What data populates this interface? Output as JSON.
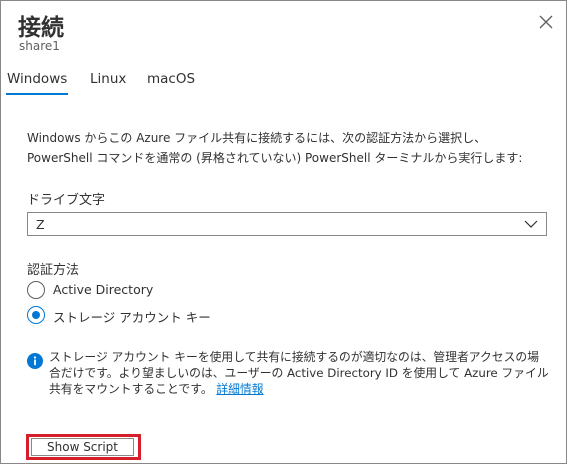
{
  "header": {
    "title": "接続",
    "subtitle": "share1",
    "close_icon": "close-icon"
  },
  "tabs": [
    {
      "label": "Windows",
      "active": true
    },
    {
      "label": "Linux",
      "active": false
    },
    {
      "label": "macOS",
      "active": false
    }
  ],
  "description": {
    "line1": "Windows からこの Azure ファイル共有に接続するには、次の認証方法から選択し、",
    "line2": "PowerShell コマンドを通常の (昇格されていない) PowerShell ターミナルから実行します:"
  },
  "drive": {
    "label": "ドライブ文字",
    "value": "Z"
  },
  "auth": {
    "label": "認証方法",
    "options": [
      {
        "label": "Active Directory",
        "selected": false
      },
      {
        "label": "ストレージ アカウント キー",
        "selected": true
      }
    ]
  },
  "info": {
    "text": "ストレージ アカウント キーを使用して共有に接続するのが適切なのは、管理者アクセスの場合だけです。より望ましいのは、ユーザーの Active Directory ID を使用して Azure ファイル共有をマウントすることです。",
    "link": "詳細情報"
  },
  "actions": {
    "show_script": "Show Script"
  },
  "colors": {
    "accent": "#0078d4",
    "highlight": "#d61f2a",
    "text": "#323130"
  }
}
